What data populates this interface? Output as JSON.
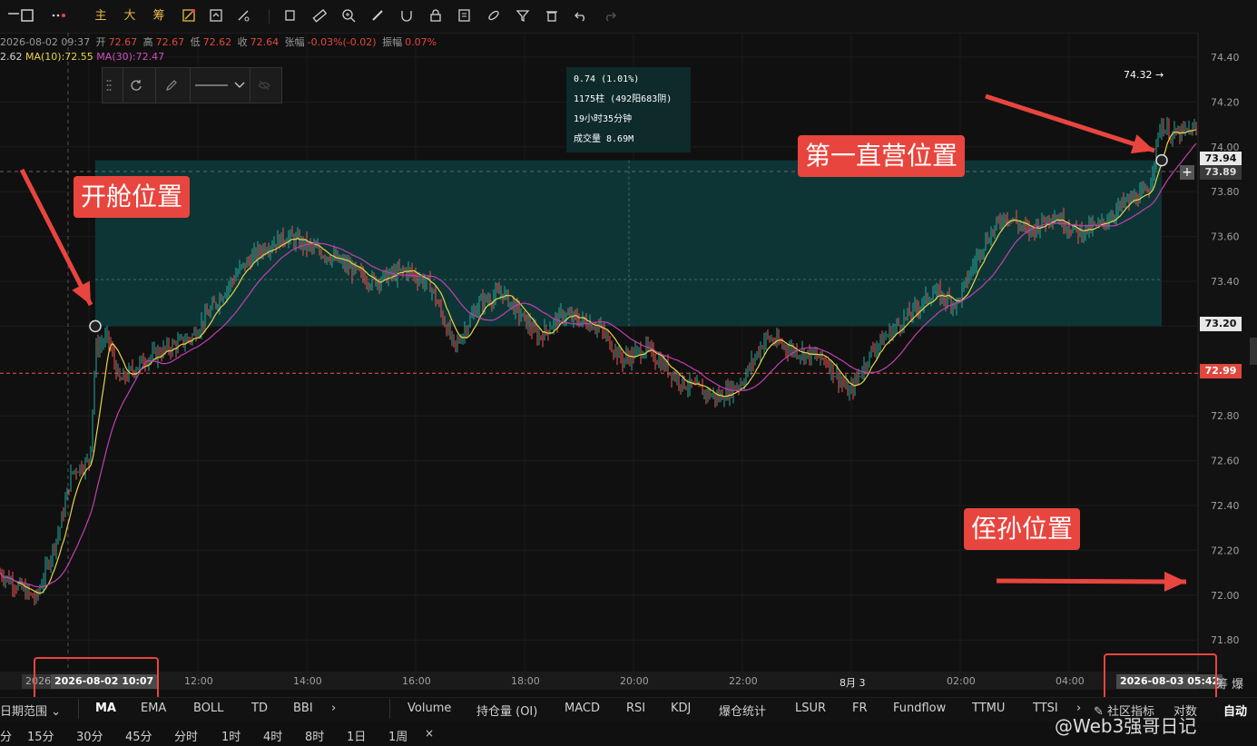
{
  "toolbar": {
    "items": [
      "主",
      "大",
      "筹"
    ]
  },
  "info": {
    "datetime": "2026-08-02 09:37",
    "open_label": "开",
    "open": "72.67",
    "high_label": "高",
    "high": "72.67",
    "low_label": "低",
    "low": "72.62",
    "close_label": "收",
    "close": "72.64",
    "change_label": "张幅",
    "change": "-0.03%(-0.02)",
    "amp_label": "振幅",
    "amp": "0.07%",
    "ma_first": "2.62",
    "ma10": "MA(10):72.55",
    "ma30": "MA(30):72.47"
  },
  "measure": {
    "line1": "0.74 (1.01%)",
    "line2": "1175柱 (492阳683阴)",
    "line3": "19小时35分钟",
    "line4": "成交量 8.69M"
  },
  "annotations": {
    "open_pos": "开舱位置",
    "direct_pos": "第一直营位置",
    "nephew_pos": "侄孙位置"
  },
  "price_axis": {
    "ticks": [
      "74.40",
      "74.20",
      "74.00",
      "73.80",
      "73.60",
      "73.40",
      "73.20",
      "72.80",
      "72.60",
      "72.40",
      "72.20",
      "72.00",
      "71.80"
    ],
    "tag_top": "73.94",
    "tag_top2": "73.89",
    "tag_box": "73.20",
    "tag_current": "72.99",
    "high_marker": "74.32 →"
  },
  "time_axis": {
    "labels": [
      "12:00",
      "14:00",
      "16:00",
      "18:00",
      "20:00",
      "22:00",
      "8月 3",
      "02:00",
      "04:00"
    ],
    "start_label": "2026-08-02 10:07",
    "start_partial": "2026",
    "end_label": "2026-08-03 05:42",
    "right_glyphs": "筹 爆"
  },
  "indicators": {
    "range_label": "日期范围",
    "main": [
      "MA",
      "EMA",
      "BOLL",
      "TD",
      "BBI"
    ],
    "sub": [
      "Volume",
      "持仓量 (OI)",
      "MACD",
      "RSI",
      "KDJ",
      "爆仓统计",
      "LSUR",
      "FR",
      "Fundflow",
      "TTMU",
      "TTSI"
    ],
    "community": "社区指标",
    "compare": "对数",
    "auto": "自动"
  },
  "intervals": [
    "分",
    "15分",
    "30分",
    "45分",
    "分时",
    "1时",
    "4时",
    "8时",
    "1日",
    "1周",
    "×"
  ],
  "watermark": "@Web3强哥日记",
  "colors": {
    "up": "#26a69a",
    "down": "#ef5350",
    "ma_yellow": "#e8d44a",
    "ma_magenta": "#c040b0",
    "box": "#0e3a3a",
    "annot": "#e8453e"
  },
  "chart_data": {
    "type": "candlestick",
    "y_range": [
      71.7,
      74.5
    ],
    "x_start": "2026-08-02 09:37",
    "x_end": "2026-08-03 06:00",
    "measure_from": 73.2,
    "measure_to": 73.94,
    "current_price": 72.99,
    "high": 74.32,
    "path_points": [
      [
        0,
        72.1
      ],
      [
        0.03,
        71.98
      ],
      [
        0.05,
        72.3
      ],
      [
        0.06,
        72.55
      ],
      [
        0.075,
        72.6
      ],
      [
        0.08,
        73.1
      ],
      [
        0.09,
        73.15
      ],
      [
        0.1,
        72.95
      ],
      [
        0.12,
        73.05
      ],
      [
        0.16,
        73.15
      ],
      [
        0.2,
        73.45
      ],
      [
        0.22,
        73.55
      ],
      [
        0.24,
        73.6
      ],
      [
        0.28,
        73.5
      ],
      [
        0.31,
        73.4
      ],
      [
        0.34,
        73.45
      ],
      [
        0.36,
        73.38
      ],
      [
        0.38,
        73.1
      ],
      [
        0.4,
        73.3
      ],
      [
        0.42,
        73.35
      ],
      [
        0.45,
        73.15
      ],
      [
        0.47,
        73.25
      ],
      [
        0.5,
        73.2
      ],
      [
        0.52,
        73.05
      ],
      [
        0.54,
        73.1
      ],
      [
        0.57,
        72.95
      ],
      [
        0.6,
        72.88
      ],
      [
        0.62,
        72.95
      ],
      [
        0.64,
        73.15
      ],
      [
        0.66,
        73.1
      ],
      [
        0.69,
        73.05
      ],
      [
        0.71,
        72.9
      ],
      [
        0.73,
        73.1
      ],
      [
        0.76,
        73.25
      ],
      [
        0.78,
        73.35
      ],
      [
        0.8,
        73.3
      ],
      [
        0.82,
        73.55
      ],
      [
        0.84,
        73.7
      ],
      [
        0.86,
        73.62
      ],
      [
        0.88,
        73.7
      ],
      [
        0.9,
        73.62
      ],
      [
        0.92,
        73.65
      ],
      [
        0.94,
        73.75
      ],
      [
        0.96,
        73.8
      ],
      [
        0.97,
        74.1
      ],
      [
        0.98,
        74.05
      ],
      [
        1.0,
        74.08
      ]
    ]
  }
}
